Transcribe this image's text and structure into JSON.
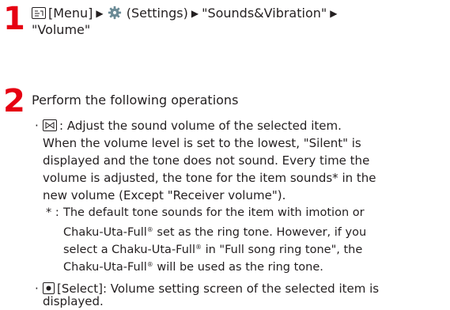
{
  "step1": {
    "number": "1",
    "menu_label": "[Menu]",
    "settings_label": "(Settings)",
    "sounds_label": "\"Sounds&Vibration\"",
    "volume_label": "\"Volume\""
  },
  "step2": {
    "number": "2",
    "title": "Perform the following operations",
    "item1": {
      "lines": [
        ": Adjust the sound volume of the selected item.",
        "When the volume level is set to the lowest, \"Silent\" is",
        "displayed and the tone does not sound. Every time the",
        "volume is adjusted, the tone for the item sounds* in the",
        "new volume (Except \"Receiver volume\")."
      ]
    },
    "footnote": {
      "mark": "* :",
      "line1": "The default tone sounds for the item with imotion or",
      "line2_a": "Chaku-Uta-Full",
      "line2_b": " set as the ring tone. However, if you",
      "line3_a": "select a Chaku-Uta-Full",
      "line3_b": " in \"Full song ring tone\", the",
      "line4_a": "Chaku-Uta-Full",
      "line4_b": " will be used as the ring tone.",
      "registered": "®"
    },
    "item2": {
      "line1": "[Select]: Volume setting screen of the selected item is",
      "line2": "displayed."
    }
  },
  "colors": {
    "step_number": "#e60012",
    "text": "#231f20"
  },
  "icons": [
    "menu-key-icon",
    "gear-icon",
    "arrow-right-icon",
    "volume-key-icon",
    "select-key-icon"
  ]
}
